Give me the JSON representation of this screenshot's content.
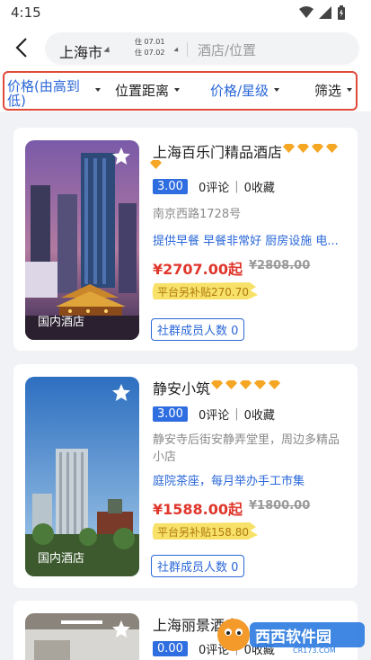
{
  "status": {
    "time": "4:15"
  },
  "search": {
    "city": "上海市",
    "checkin": "住 07.01",
    "checkout": "住 07.02",
    "placeholder": "酒店/位置"
  },
  "filters": [
    {
      "label": "价格(由高到低)",
      "active": true
    },
    {
      "label": "位置距离",
      "active": false
    },
    {
      "label": "价格/星级",
      "active": true
    },
    {
      "label": "筛选",
      "active": false
    }
  ],
  "hotels": [
    {
      "name": "上海百乐门精品酒店",
      "diamonds": 5,
      "score": "3.00",
      "reviews": "0评论",
      "favorites": "0收藏",
      "address": "南京西路1728号",
      "tags": "提供早餐 早餐非常好 厨房设施 电...",
      "price": "¥2707.00起",
      "original_price": "¥2808.00",
      "subsidy": "平台另补贴270.70",
      "members": "社群成员人数 0",
      "image_label": "国内酒店"
    },
    {
      "name": "静安小筑",
      "diamonds": 5,
      "score": "3.00",
      "reviews": "0评论",
      "favorites": "0收藏",
      "address": "静安寺后街安静弄堂里，周边多精品小店",
      "tags": "庭院茶座，每月举办手工市集",
      "price": "¥1588.00起",
      "original_price": "¥1800.00",
      "subsidy": "平台另补贴158.80",
      "members": "社群成员人数 0",
      "image_label": "国内酒店"
    },
    {
      "name": "上海丽景酒店",
      "score": "0.00",
      "reviews": "0评论",
      "favorites": "0收藏"
    }
  ],
  "watermark": {
    "text": "西西软件园",
    "sub": "CR173.COM"
  },
  "colors": {
    "accent": "#2a67d8",
    "price": "#e0362c",
    "highlight": "#e04a3a"
  }
}
